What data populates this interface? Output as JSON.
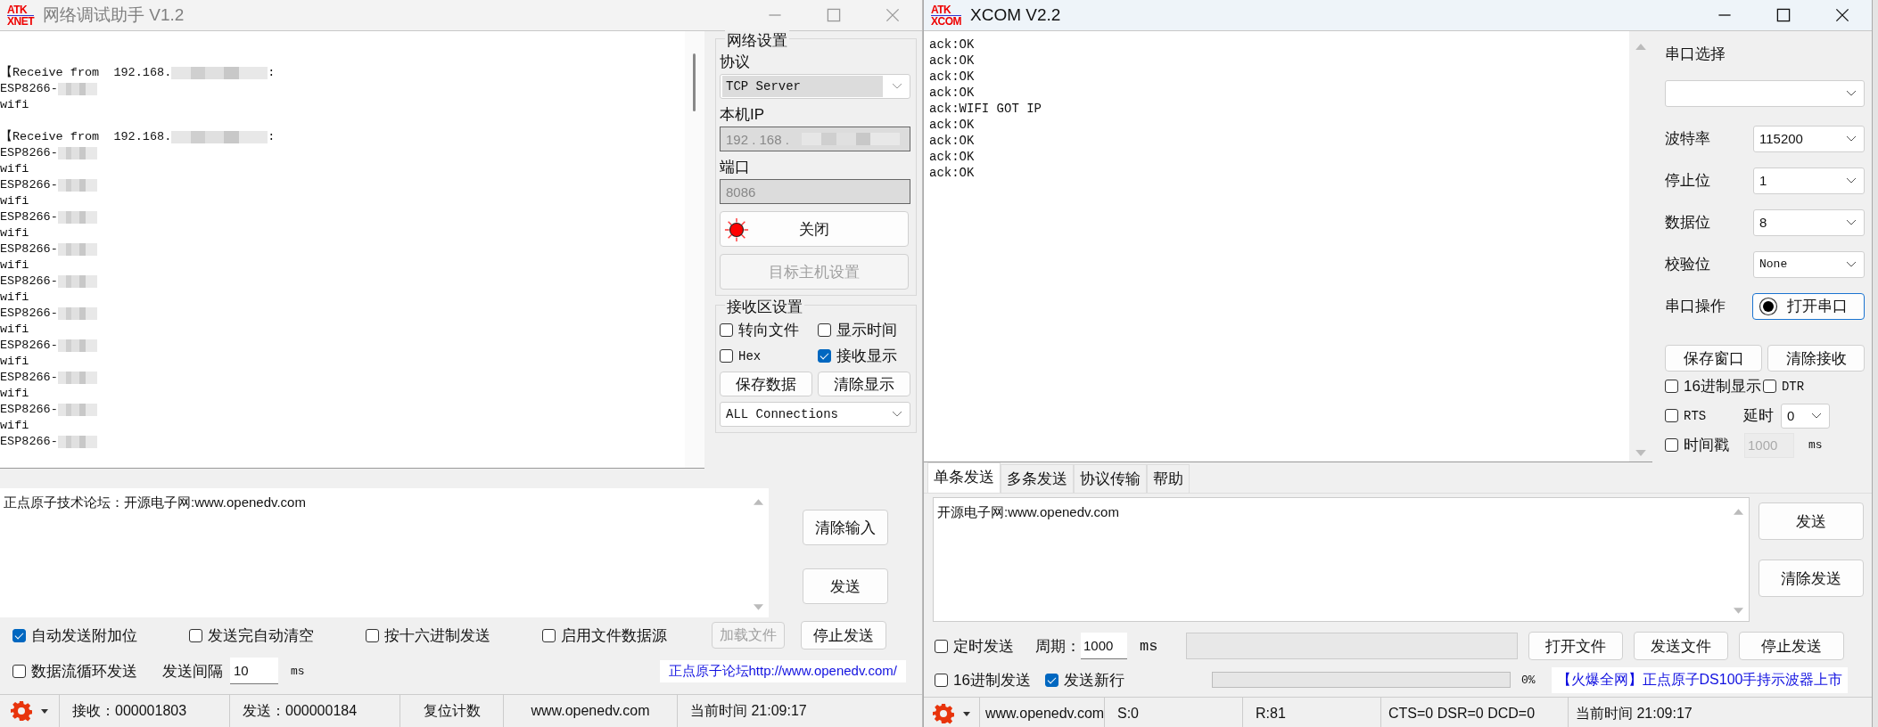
{
  "left_window": {
    "logo": [
      "ATK",
      "XNET"
    ],
    "title": "网络调试助手 V1.2",
    "receive_lines": [
      {
        "kind": "header",
        "text": "【Receive from  192.168.",
        "redacted": true,
        "suffix": ":"
      },
      {
        "kind": "data",
        "text": "ESP8266-",
        "redacted": true
      },
      {
        "kind": "data",
        "text": "wifi",
        "redacted": false
      },
      {
        "kind": "header",
        "text": "【Receive from  192.168.",
        "redacted": true,
        "suffix": ":"
      },
      {
        "kind": "data",
        "text": "ESP8266-",
        "redacted": true
      },
      {
        "kind": "data",
        "text": "wifi",
        "redacted": false
      },
      {
        "kind": "data",
        "text": "ESP8266-",
        "redacted": true
      },
      {
        "kind": "data",
        "text": "wifi",
        "redacted": false
      },
      {
        "kind": "data",
        "text": "ESP8266-",
        "redacted": true
      },
      {
        "kind": "data",
        "text": "wifi",
        "redacted": false
      },
      {
        "kind": "data",
        "text": "ESP8266-",
        "redacted": true
      },
      {
        "kind": "data",
        "text": "wifi",
        "redacted": false
      },
      {
        "kind": "data",
        "text": "ESP8266-",
        "redacted": true
      },
      {
        "kind": "data",
        "text": "wifi",
        "redacted": false
      },
      {
        "kind": "data",
        "text": "ESP8266-",
        "redacted": true
      },
      {
        "kind": "data",
        "text": "wifi",
        "redacted": false
      },
      {
        "kind": "data",
        "text": "ESP8266-",
        "redacted": true
      },
      {
        "kind": "data",
        "text": "wifi",
        "redacted": false
      },
      {
        "kind": "data",
        "text": "ESP8266-",
        "redacted": true
      },
      {
        "kind": "data",
        "text": "wifi",
        "redacted": false
      },
      {
        "kind": "data",
        "text": "ESP8266-",
        "redacted": true
      },
      {
        "kind": "data",
        "text": "wifi",
        "redacted": false
      },
      {
        "kind": "data",
        "text": "ESP8266-",
        "redacted": true
      }
    ],
    "network_settings": {
      "title": "网络设置",
      "protocol_label": "协议",
      "protocol": "TCP Server",
      "ip_label": "本机IP",
      "ip_value": "192 . 168 .",
      "ip_redacted": true,
      "port_label": "端口",
      "port": "8086",
      "connect_button": {
        "label": "关闭",
        "connected": true
      },
      "target_button": {
        "label": "目标主机设置",
        "disabled": true
      }
    },
    "receive_settings": {
      "title": "接收区设置",
      "options": [
        {
          "label": "转向文件",
          "checked": false
        },
        {
          "label": "显示时间",
          "checked": false
        },
        {
          "label": "Hex",
          "checked": false
        },
        {
          "label": "接收显示",
          "checked": true
        }
      ],
      "buttons": [
        "保存数据",
        "清除显示"
      ],
      "connections": "ALL Connections"
    },
    "send_text": "正点原子技术论坛：开源电子网:www.openedv.com",
    "send_buttons": [
      "清除输入",
      "发送"
    ],
    "options": [
      {
        "label": "自动发送附加位",
        "checked": true
      },
      {
        "label": "发送完自动清空",
        "checked": false
      },
      {
        "label": "按十六进制发送",
        "checked": false
      },
      {
        "label": "启用文件数据源",
        "checked": false
      }
    ],
    "load_file_button": {
      "label": "加载文件",
      "disabled": true
    },
    "stop_button": "停止发送",
    "loop_option": {
      "label": "数据流循环发送",
      "checked": false
    },
    "interval_label": "发送间隔",
    "interval": "10",
    "interval_unit": "ms",
    "forum_link": "正点原子论坛http://www.openedv.com/",
    "status_bar": {
      "received": "接收：000001803",
      "sent": "发送：000000184",
      "reset_button": "复位计数",
      "website": "www.openedv.com",
      "time": "当前时间 21:09:17"
    }
  },
  "right_window": {
    "logo": [
      "ATK",
      "XCOM"
    ],
    "title": "XCOM V2.2",
    "receive_lines": [
      "ack:OK",
      "ack:OK",
      "ack:OK",
      "ack:OK",
      "ack:WIFI GOT IP",
      "ack:OK",
      "ack:OK",
      "ack:OK",
      "ack:OK"
    ],
    "port_label": "串口选择",
    "fields": [
      {
        "label": "波特率",
        "value": "115200"
      },
      {
        "label": "停止位",
        "value": "1"
      },
      {
        "label": "数据位",
        "value": "8"
      },
      {
        "label": "校验位",
        "value": "None"
      }
    ],
    "operation_label": "串口操作",
    "open_button": {
      "label": "打开串口",
      "open": false
    },
    "buttons": [
      "保存窗口",
      "清除接收"
    ],
    "hex_display": {
      "label": "16进制显示",
      "checked": false
    },
    "dtr": {
      "label": "DTR",
      "checked": false
    },
    "rts": {
      "label": "RTS",
      "checked": false
    },
    "delay_label": "延时",
    "delay": "0",
    "timestamp": {
      "label": "时间戳",
      "checked": false
    },
    "timestamp_value": "1000",
    "timestamp_unit": "ms",
    "tabs": [
      {
        "label": "单条发送",
        "selected": true
      },
      {
        "label": "多条发送",
        "selected": false
      },
      {
        "label": "协议传输",
        "selected": false
      },
      {
        "label": "帮助",
        "selected": false
      }
    ],
    "send_text": "开源电子网:www.openedv.com",
    "send_buttons": [
      "发送",
      "清除发送"
    ],
    "timed_send": {
      "label": "定时发送",
      "checked": false
    },
    "period_label": "周期：",
    "period": "1000",
    "period_unit": "ms",
    "file_buttons": [
      "打开文件",
      "发送文件",
      "停止发送"
    ],
    "hex_send": {
      "label": "16进制发送",
      "checked": false
    },
    "new_line": {
      "label": "发送新行",
      "checked": true
    },
    "progress": {
      "level": 0,
      "reading": "0%"
    },
    "ad_link": "【火爆全网】正点原子DS100手持示波器上市",
    "status_bar": {
      "website": "www.openedv.com",
      "sent": "S:0",
      "received": "R:81",
      "lines": "CTS=0 DSR=0 DCD=0",
      "time": "当前时间 21:09:17"
    }
  }
}
